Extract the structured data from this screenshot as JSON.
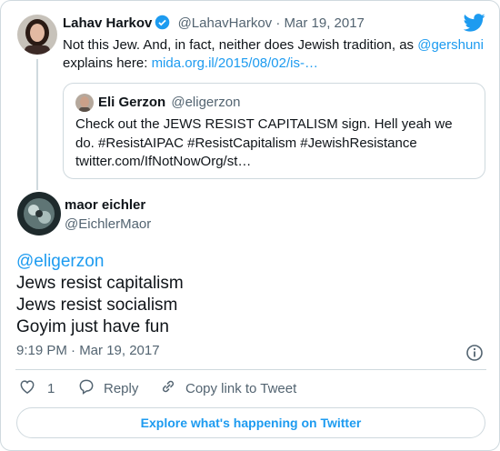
{
  "colors": {
    "accent": "#1d9bf0",
    "text": "#0f1419",
    "muted": "#536471",
    "border": "#cfd9de"
  },
  "parent": {
    "name": "Lahav Harkov",
    "handle": "@LahavHarkov",
    "dot": "·",
    "date": "Mar 19, 2017",
    "text_before": "Not this Jew. And, in fact, neither does Jewish tradition, as ",
    "mention": "@gershuni",
    "text_line2": "explains here: ",
    "link": "mida.org.il/2015/08/02/is-…"
  },
  "quote": {
    "name": "Eli Gerzon",
    "handle": "@eligerzon",
    "line1": "Check out the JEWS RESIST CAPITALISM sign. Hell yeah we",
    "line2": "do. #ResistAIPAC #ResistCapitalism #JewishResistance",
    "line3": "twitter.com/IfNotNowOrg/st…"
  },
  "reply": {
    "name": "maor eichler",
    "handle": "@EichlerMaor",
    "mention": "@eligerzon",
    "line1": "Jews resist capitalism",
    "line2": "Jews resist socialism",
    "line3": "Goyim just have fun",
    "timestamp": "9:19 PM · Mar 19, 2017"
  },
  "actions": {
    "like_count": "1",
    "reply_label": "Reply",
    "copy_label": "Copy link to Tweet"
  },
  "explore_label": "Explore what's happening on Twitter",
  "icons": [
    "twitter-bird-icon",
    "verified-badge-icon",
    "info-icon",
    "heart-icon",
    "reply-icon",
    "link-icon"
  ]
}
